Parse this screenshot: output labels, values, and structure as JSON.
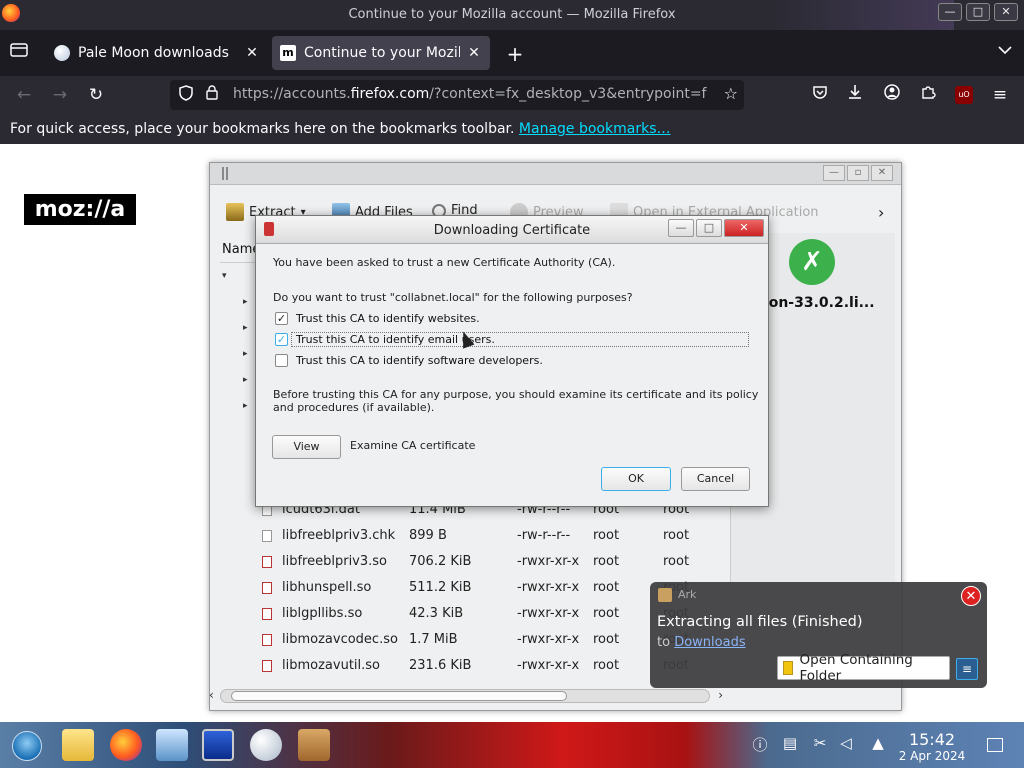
{
  "window": {
    "title": "Continue to your Mozilla account — Mozilla Firefox",
    "controls": [
      "—",
      "□",
      "✕"
    ]
  },
  "tabs": [
    {
      "label": "Pale Moon downloads",
      "active": false
    },
    {
      "label": "Continue to your Mozilla account",
      "favicon_text": "m",
      "active": true
    }
  ],
  "tab_strip": {
    "new_tab": "+",
    "overflow": "⌄",
    "list_icon": "▭"
  },
  "navbar": {
    "url_prefix": "https://accounts.",
    "url_host": "firefox.com",
    "url_rest": "/?context=fx_desktop_v3&entrypoint=f",
    "ublock_label": "uO"
  },
  "bookmarks_bar": {
    "text": "For quick access, place your bookmarks here on the bookmarks toolbar.",
    "link": "Manage bookmarks…"
  },
  "page": {
    "logo": "moz://a"
  },
  "ark": {
    "toolbar": {
      "extract": "Extract",
      "add_files": "Add Files",
      "find": "Find",
      "preview": "Preview",
      "open_external": "Open in External Application",
      "more": "›"
    },
    "column_name": "Name",
    "rows": [
      {
        "name": "icudt63l.dat",
        "size": "11.4 MiB",
        "perms": "-rw-r--r--",
        "owner": "root",
        "group": "root"
      },
      {
        "name": "libfreeblpriv3.chk",
        "size": "899 B",
        "perms": "-rw-r--r--",
        "owner": "root",
        "group": "root"
      },
      {
        "name": "libfreeblpriv3.so",
        "size": "706.2 KiB",
        "perms": "-rwxr-xr-x",
        "owner": "root",
        "group": "root"
      },
      {
        "name": "libhunspell.so",
        "size": "511.2 KiB",
        "perms": "-rwxr-xr-x",
        "owner": "root",
        "group": "root"
      },
      {
        "name": "liblgpllibs.so",
        "size": "42.3 KiB",
        "perms": "-rwxr-xr-x",
        "owner": "root",
        "group": "root"
      },
      {
        "name": "libmozavcodec.so",
        "size": "1.7 MiB",
        "perms": "-rwxr-xr-x",
        "owner": "root",
        "group": "root"
      },
      {
        "name": "libmozavutil.so",
        "size": "231.6 KiB",
        "perms": "-rwxr-xr-x",
        "owner": "root",
        "group": "root"
      }
    ],
    "preview_name": "palemoon-33.0.2.li...",
    "preview_name_visible": "emoon-33.0.2.li..."
  },
  "dialog": {
    "title": "Downloading Certificate",
    "intro": "You have been asked to trust a new Certificate Authority (CA).",
    "question": "Do you want to trust \"collabnet.local\" for the following purposes?",
    "options": [
      {
        "label": "Trust this CA to identify websites.",
        "checked": true
      },
      {
        "label": "Trust this CA to identify email users.",
        "checked": true
      },
      {
        "label": "Trust this CA to identify software developers.",
        "checked": false
      }
    ],
    "advice_line1": "Before trusting this CA for any purpose, you should examine its certificate and its policy",
    "advice_line2": "and procedures (if available).",
    "view_button": "View",
    "examine_label": "Examine CA certificate",
    "ok_button": "OK",
    "cancel_button": "Cancel"
  },
  "notification": {
    "app": "Ark",
    "heading": "Extracting all files (Finished)",
    "body_prefix": "to",
    "body_link": "Downloads",
    "action": "Open Containing Folder",
    "close": "✕"
  },
  "taskbar": {
    "time": "15:42",
    "date": "2 Apr 2024"
  }
}
